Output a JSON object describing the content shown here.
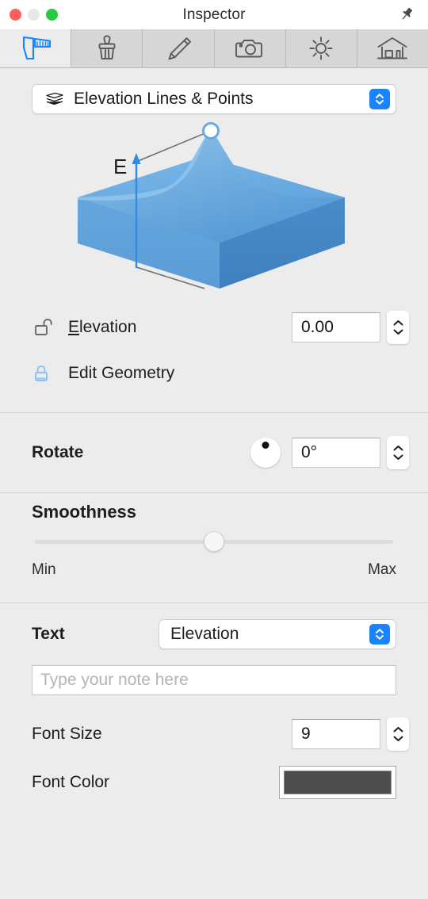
{
  "window": {
    "title": "Inspector",
    "traffic_lights": [
      "close",
      "minimize",
      "zoom"
    ],
    "pin_icon": "pushpin-icon"
  },
  "tabs": [
    {
      "name": "caliper",
      "icon": "caliper-icon",
      "active": true
    },
    {
      "name": "brush",
      "icon": "brush-icon",
      "active": false
    },
    {
      "name": "pencil",
      "icon": "pencil-icon",
      "active": false
    },
    {
      "name": "camera",
      "icon": "camera-icon",
      "active": false
    },
    {
      "name": "sun",
      "icon": "sun-icon",
      "active": false
    },
    {
      "name": "house",
      "icon": "house-icon",
      "active": false
    }
  ],
  "layer_popup": {
    "value": "Elevation Lines & Points",
    "icon": "layers-icon"
  },
  "illustration": {
    "name": "terrain-elevation-diagram",
    "arrow_label": "E"
  },
  "elevation": {
    "label_prefix": "E",
    "label_rest": "levation",
    "value": "0.00",
    "lock_icon": "unlocked-padlock-icon"
  },
  "edit_geometry": {
    "label": "Edit Geometry",
    "lock_icon": "locked-padlock-icon"
  },
  "rotate": {
    "label": "Rotate",
    "value": "0°",
    "knob_angle": 0
  },
  "smoothness": {
    "title": "Smoothness",
    "min_label": "Min",
    "max_label": "Max",
    "value_percent": 50
  },
  "text_section": {
    "label": "Text",
    "popup_value": "Elevation",
    "note_placeholder": "Type your note here",
    "note_value": ""
  },
  "font_size": {
    "label": "Font Size",
    "value": "9"
  },
  "font_color": {
    "label": "Font Color",
    "color": "#4d4d4d"
  },
  "colors": {
    "accent_blue": "#1a84ff",
    "panel_bg": "#ececec",
    "tab_bg": "#d6d6d6",
    "terrain_blue": "#5ea2dd",
    "terrain_blue_dark": "#4a8fd0",
    "lock_blue": "#8ec0f5"
  }
}
